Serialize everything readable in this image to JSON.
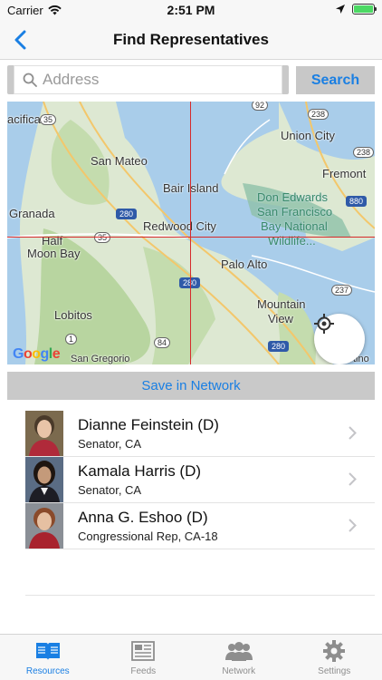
{
  "status_bar": {
    "carrier": "Carrier",
    "time": "2:51 PM",
    "battery_level": 1.0
  },
  "nav": {
    "title": "Find Representatives",
    "back_icon": "chevron-left-icon"
  },
  "search": {
    "placeholder": "Address",
    "value": "",
    "button_label": "Search"
  },
  "map": {
    "labels": {
      "pacifica": "acifica",
      "san_mateo": "San Mateo",
      "union_city": "Union City",
      "fremont": "Fremont",
      "bair_island": "Bair Island",
      "granada": "Granada",
      "redwood_city": "Redwood City",
      "don_edwards_1": "Don Edwards",
      "don_edwards_2": "San Francisco",
      "don_edwards_3": "Bay National",
      "don_edwards_4": "Wildlife...",
      "half_moon_1": "Half",
      "half_moon_2": "Moon Bay",
      "palo_alto": "Palo Alto",
      "mountain_view_1": "Mountain",
      "mountain_view_2": "View",
      "lobitos": "Lobitos",
      "san_gregorio": "San Gregorio",
      "cupertino": "Cupertino"
    },
    "shields": {
      "r92": "92",
      "r238a": "238",
      "r238b": "238",
      "r35a": "35",
      "r280a": "280",
      "r880": "880",
      "r35b": "35",
      "r280b": "280",
      "r237": "237",
      "r1": "1",
      "r84": "84",
      "r280c": "280"
    },
    "attribution": "Google",
    "locate_icon": "location-target-icon"
  },
  "save_network_label": "Save in Network",
  "representatives": [
    {
      "name": "Dianne Feinstein (D)",
      "role": "Senator, CA"
    },
    {
      "name": "Kamala Harris (D)",
      "role": "Senator, CA"
    },
    {
      "name": "Anna G. Eshoo (D)",
      "role": "Congressional Rep, CA-18"
    }
  ],
  "tabs": [
    {
      "label": "Resources",
      "icon": "book-icon",
      "active": true
    },
    {
      "label": "Feeds",
      "icon": "newspaper-icon",
      "active": false
    },
    {
      "label": "Network",
      "icon": "people-icon",
      "active": false
    },
    {
      "label": "Settings",
      "icon": "gear-icon",
      "active": false
    }
  ],
  "colors": {
    "accent": "#1a7fe3",
    "crosshair": "#d62b2b"
  }
}
